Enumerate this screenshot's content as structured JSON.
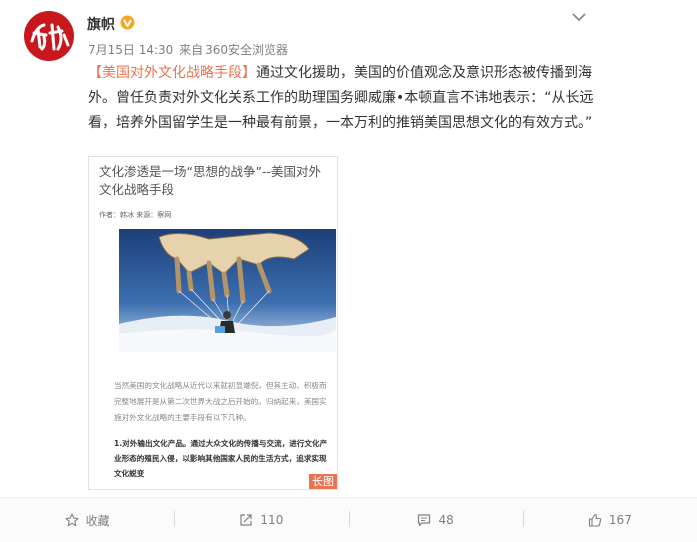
{
  "post": {
    "username": "旗帜",
    "verified": true,
    "avatar_text": "旗帜",
    "date": "7月15日 14:30",
    "source_prefix": "来自",
    "source": "360安全浏览器",
    "topic": "【美国对外文化战略手段】",
    "body": "通过文化援助，美国的价值观念及意识形态被传播到海外。曾任负责对外文化关系工作的助理国务卿威廉•本顿直言不讳地表示：“从长远看，培养外国留学生是一种最有前景，一本万利的推销美国思想文化的有效方式。”"
  },
  "thumbnail": {
    "title": "文化渗透是一场“思想的战争”--美国对外文化战略手段",
    "author_line": "作者：韩冰 来源：察网",
    "body_text": "当然美国的文化战略从近代以来就初显端倪，但其主动、积极而完整地展开是从第二次世界大战之后开始的。归纳起来，美国实施对外文化战略的主要手段有以下几种。",
    "bold_text": "1.对外输出文化产品。通过大众文化的传播与交流，进行文化产业形态的殖民入侵，以影响其他国家人民的生活方式，追求实现文化蜕变",
    "badge": "长图"
  },
  "actions": {
    "favorite_label": "收藏",
    "repost_count": "110",
    "comment_count": "48",
    "like_count": "167"
  },
  "icons": [
    "verified-badge-icon",
    "chevron-down-icon",
    "star-icon",
    "repost-icon",
    "comment-icon",
    "thumbs-up-icon"
  ],
  "colors": {
    "accent": "#eb7350",
    "verified": "#f6a623",
    "avatar_bg": "#c8181e"
  }
}
